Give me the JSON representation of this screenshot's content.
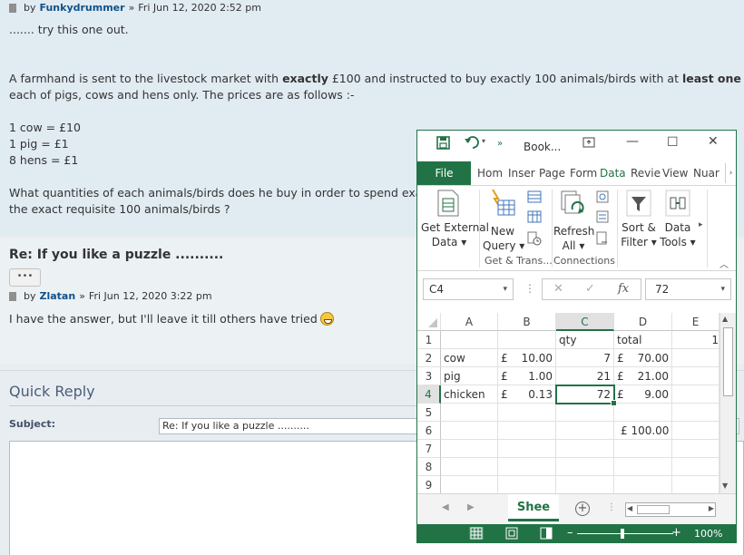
{
  "post1": {
    "by": "by",
    "author": "Funkydrummer",
    "sep": "»",
    "date": "Fri Jun 12, 2020 2:52 pm",
    "line1": "....... try this one out.",
    "line2a": "A farmhand is sent to the livestock market with ",
    "line2b": "exactly",
    "line2c": " £100 and instructed to buy exactly 100 animals/birds with at ",
    "line2d": "least one",
    "line3": "each of pigs, cows and hens only. The prices are as follows :-",
    "price1": "1 cow = £10",
    "price2": "1 pig = £1",
    "price3": "8 hens = £1",
    "line4": "What quantities of each animals/birds does he buy in order to spend exactly",
    "line5": "the exact requisite 100 animals/birds ?"
  },
  "post2": {
    "title": "Re: If you like a puzzle ..........",
    "more": "•••",
    "by": "by",
    "author": "Zlatan",
    "sep": "»",
    "date": "Fri Jun 12, 2020 3:22 pm",
    "body": "I have the answer, but I'll leave it till others have tried"
  },
  "quick_reply": {
    "title": "Quick Reply",
    "subject_label": "Subject:",
    "subject_value": "Re: If you like a puzzle .........."
  },
  "excel": {
    "title": "Book...",
    "tabs": {
      "file": "File",
      "home": "Hom",
      "insert": "Inser",
      "page": "Page",
      "formulas": "Form",
      "data": "Data",
      "review": "Revie",
      "view": "View",
      "nuance": "Nuar"
    },
    "ribbon": {
      "get_external_1": "Get External",
      "get_external_2": "Data ▾",
      "new_query_1": "New",
      "new_query_2": "Query ▾",
      "refresh_1": "Refresh",
      "refresh_2": "All ▾",
      "sort_1": "Sort &",
      "sort_2": "Filter ▾",
      "data_tools_1": "Data",
      "data_tools_2": "Tools ▾",
      "group_get": "Get & Trans...",
      "group_connections": "Connections"
    },
    "formula_bar": {
      "name_box": "C4",
      "cancel": "✕",
      "enter": "✓",
      "fx": "fx",
      "value": "72"
    },
    "columns": [
      "A",
      "B",
      "C",
      "D",
      "E"
    ],
    "rows": [
      "1",
      "2",
      "3",
      "4",
      "5",
      "6",
      "7",
      "8",
      "9"
    ],
    "cells": {
      "C1": "qty",
      "D1": "total",
      "E1": "1",
      "A2": "cow",
      "B2_cur": "£",
      "B2": "10.00",
      "C2": "7",
      "D2_cur": "£",
      "D2": "70.00",
      "A3": "pig",
      "B3_cur": "£",
      "B3": "1.00",
      "C3": "21",
      "D3_cur": "£",
      "D3": "21.00",
      "A4": "chicken",
      "B4_cur": "£",
      "B4": "0.13",
      "C4": "72",
      "D4_cur": "£",
      "D4": "9.00",
      "D6": "£ 100.00"
    },
    "sheet_tab": "Shee",
    "zoom": "100%",
    "colors": {
      "excel_green": "#217346",
      "link_blue": "#105289"
    }
  }
}
